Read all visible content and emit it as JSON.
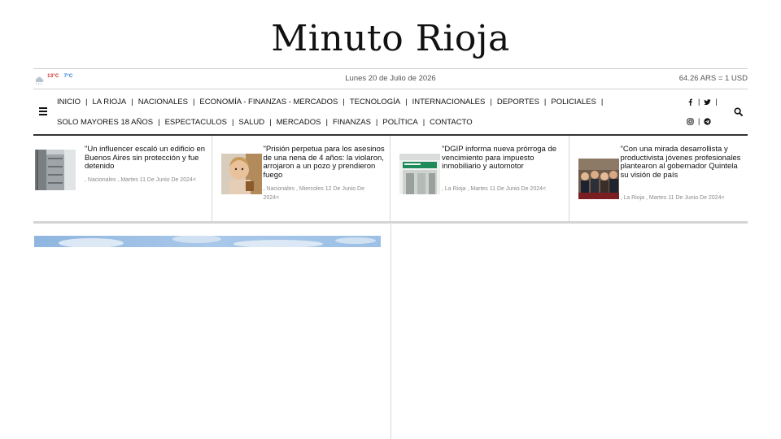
{
  "site": {
    "title": "Minuto Rioja"
  },
  "topbar": {
    "weather": {
      "icon": "cloud-icon",
      "temp_max": "13°C",
      "temp_min": "7°C"
    },
    "date": "Lunes 20 de Julio de 2026",
    "exchange_rate": "64.26 ARS = 1 USD"
  },
  "nav": {
    "row1": [
      "INICIO",
      "LA RIOJA",
      "NACIONALES",
      "ECONOMÍA - FINANZAS - MERCADOS",
      "TECNOLOGÍA",
      "INTERNACIONALES",
      "DEPORTES",
      "POLICIALES"
    ],
    "row2": [
      "SOLO MAYORES 18 AÑOS",
      "ESPECTACULOS",
      "SALUD",
      "MERCADOS",
      "FINANZAS",
      "POLÍTICA",
      "CONTACTO"
    ],
    "separator": "|",
    "social_row1": [
      "facebook-icon",
      "twitter-icon"
    ],
    "social_row2": [
      "instagram-icon",
      "telegram-icon"
    ]
  },
  "cards": [
    {
      "headline": "\"Un influencer escaló un edificio en Buenos Aires sin protección y fue detenido",
      "meta": ", Nacionales , Martes 11 De Junio De 2024<"
    },
    {
      "headline": "\"Prisión perpetua para los asesinos de una nena de 4 años: la violaron, arrojaron a un pozo y prendieron fuego",
      "meta": ", Nacionales , Miercoles 12 De Junio De 2024<"
    },
    {
      "headline": "\"DGIP informa nueva prórroga de vencimiento para impuesto inmobiliario y automotor",
      "meta": ", La Rioja , Martes 11 De Junio De 2024<"
    },
    {
      "headline": "\"Con una mirada desarrollista y productivista jóvenes profesionales plantearon al gobernador Quintela su visión de país",
      "meta": ", La Rioja , Martes 11 De Junio De 2024<"
    }
  ],
  "colors": {
    "temp_max": "#d0312d",
    "temp_min": "#2b7bd6",
    "nav_border": "#333333"
  }
}
